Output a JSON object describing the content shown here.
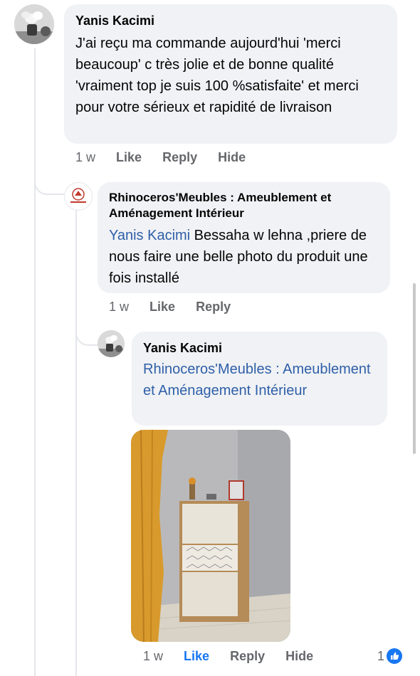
{
  "comment1": {
    "author": "Yanis Kacimi",
    "text": "J'ai reçu ma commande aujourd'hui 'merci beaucoup' c très jolie et de bonne qualité 'vraiment top je suis 100 %satisfaite' et merci pour votre sérieux et rapidité de livraison",
    "time": "1 w",
    "like": "Like",
    "reply": "Reply",
    "hide": "Hide"
  },
  "reply1": {
    "author": "Rhinoceros'Meubles : Ameublement et Aménagement Intérieur",
    "mention": "Yanis Kacimi",
    "text": " Bessaha w lehna ,priere de nous faire une belle photo du produit une fois installé",
    "time": "1 w",
    "like": "Like",
    "reply": "Reply"
  },
  "reply2": {
    "author": "Yanis Kacimi",
    "mention": "Rhinoceros'Meubles : Ameublement et Aménagement Intérieur",
    "time": "1 w",
    "like": "Like",
    "reply": "Reply",
    "hide": "Hide",
    "reaction_count": "1",
    "reaction_color": "#1877f2"
  },
  "colors": {
    "link": "#2f5fa8",
    "like_active": "#1877f2",
    "meta": "#65676b"
  }
}
